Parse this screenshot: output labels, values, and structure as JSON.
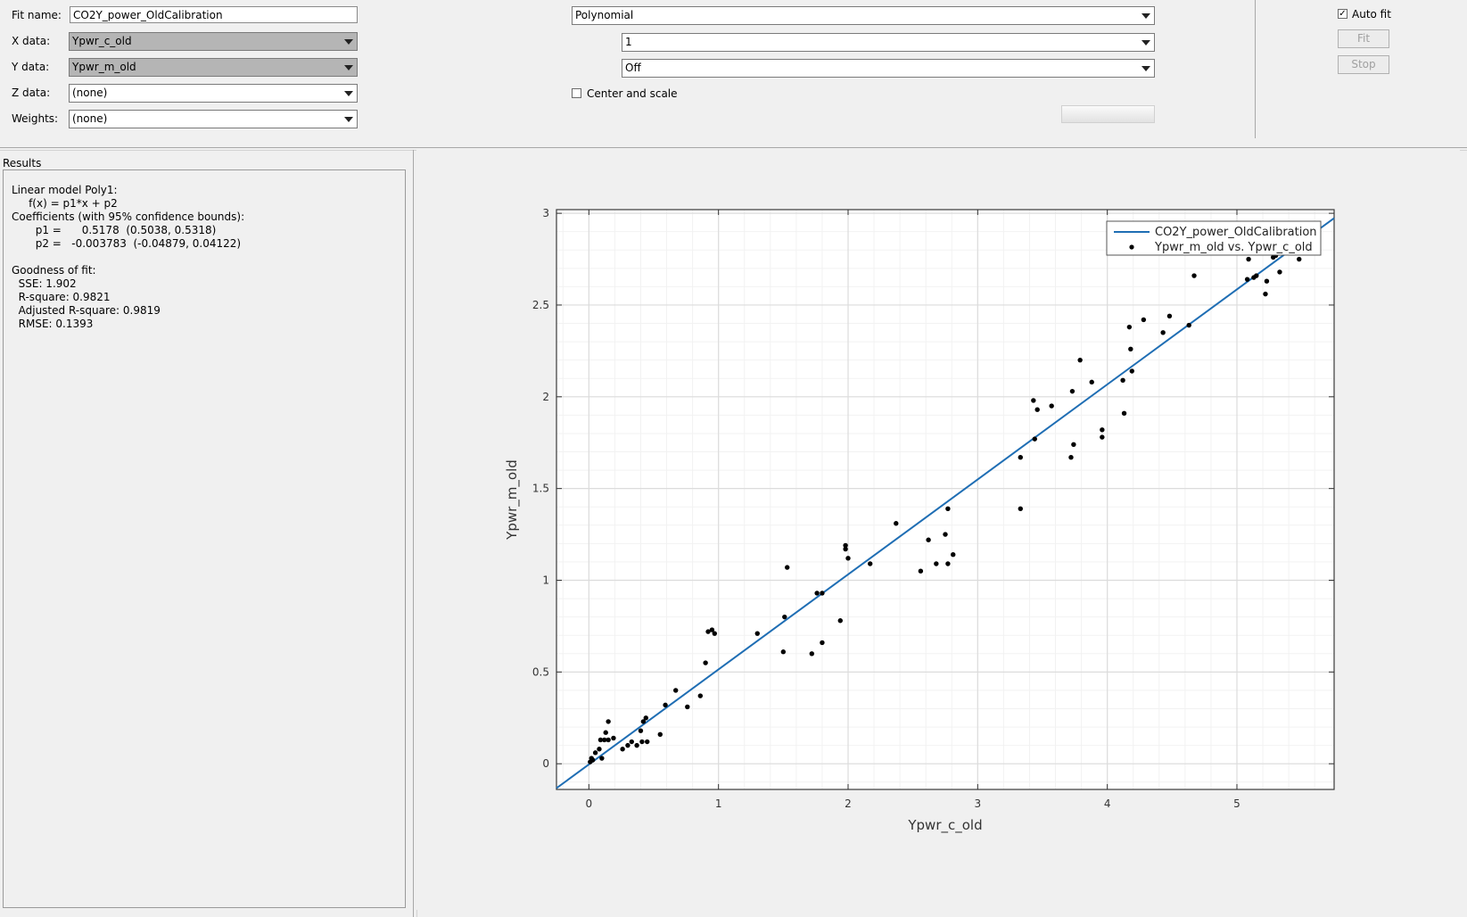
{
  "fit_panel": {
    "fit_name_label": "Fit name:",
    "fit_name_value": "CO2Y_power_OldCalibration",
    "x_data_label": "X data:",
    "x_data_value": "Ypwr_c_old",
    "y_data_label": "Y data:",
    "y_data_value": "Ypwr_m_old",
    "z_data_label": "Z data:",
    "z_data_value": "(none)",
    "weights_label": "Weights:",
    "weights_value": "(none)"
  },
  "fit_type": {
    "type_value": "Polynomial",
    "degree_value": "1",
    "robust_value": "Off",
    "center_scale_label": "Center and scale",
    "center_scale_checked": false
  },
  "actions": {
    "auto_fit_label": "Auto fit",
    "auto_fit_checked": true,
    "fit_label": "Fit",
    "stop_label": "Stop"
  },
  "results": {
    "title": "Results",
    "lines": [
      "Linear model Poly1:",
      "     f(x) = p1*x + p2",
      "Coefficients (with 95% confidence bounds):",
      "       p1 =      0.5178  (0.5038, 0.5318)",
      "       p2 =   -0.003783  (-0.04879, 0.04122)",
      "",
      "Goodness of fit:",
      "  SSE: 1.902",
      "  R-square: 0.9821",
      "  Adjusted R-square: 0.9819",
      "  RMSE: 0.1393"
    ]
  },
  "chart_data": {
    "type": "scatter",
    "xlabel": "Ypwr_c_old",
    "ylabel": "Ypwr_m_old",
    "xlim": [
      -0.25,
      5.75
    ],
    "ylim": [
      -0.14,
      3.02
    ],
    "xticks": [
      0,
      1,
      2,
      3,
      4,
      5
    ],
    "yticks": [
      0,
      0.5,
      1,
      1.5,
      2,
      2.5,
      3
    ],
    "ytick_labels": [
      "0",
      "0.5",
      "1",
      "1.5",
      "2",
      "2.5",
      "3"
    ],
    "grid": true,
    "legend_position": "top-right",
    "fit": {
      "name": "CO2Y_power_OldCalibration",
      "p1": 0.5178,
      "p2": -0.003783,
      "color": "#1f6eb4"
    },
    "series": [
      {
        "name": "Ypwr_m_old vs. Ypwr_c_old",
        "color": "#000000",
        "points": [
          [
            0.01,
            0.01
          ],
          [
            0.02,
            0.03
          ],
          [
            0.03,
            0.02
          ],
          [
            0.05,
            0.06
          ],
          [
            0.08,
            0.08
          ],
          [
            0.09,
            0.13
          ],
          [
            0.1,
            0.03
          ],
          [
            0.12,
            0.13
          ],
          [
            0.13,
            0.17
          ],
          [
            0.15,
            0.23
          ],
          [
            0.15,
            0.13
          ],
          [
            0.19,
            0.14
          ],
          [
            0.26,
            0.08
          ],
          [
            0.3,
            0.1
          ],
          [
            0.33,
            0.12
          ],
          [
            0.37,
            0.1
          ],
          [
            0.4,
            0.18
          ],
          [
            0.41,
            0.12
          ],
          [
            0.42,
            0.23
          ],
          [
            0.44,
            0.25
          ],
          [
            0.45,
            0.12
          ],
          [
            0.55,
            0.16
          ],
          [
            0.59,
            0.32
          ],
          [
            0.67,
            0.4
          ],
          [
            0.76,
            0.31
          ],
          [
            0.86,
            0.37
          ],
          [
            0.9,
            0.55
          ],
          [
            0.92,
            0.72
          ],
          [
            0.95,
            0.73
          ],
          [
            0.97,
            0.71
          ],
          [
            1.3,
            0.71
          ],
          [
            1.5,
            0.61
          ],
          [
            1.51,
            0.8
          ],
          [
            1.53,
            1.07
          ],
          [
            1.72,
            0.6
          ],
          [
            1.76,
            0.93
          ],
          [
            1.8,
            0.93
          ],
          [
            1.8,
            0.66
          ],
          [
            1.94,
            0.78
          ],
          [
            1.98,
            1.19
          ],
          [
            1.98,
            1.17
          ],
          [
            2.0,
            1.12
          ],
          [
            2.17,
            1.09
          ],
          [
            2.37,
            1.31
          ],
          [
            2.56,
            1.05
          ],
          [
            2.62,
            1.22
          ],
          [
            2.68,
            1.09
          ],
          [
            2.75,
            1.25
          ],
          [
            2.77,
            1.39
          ],
          [
            2.77,
            1.09
          ],
          [
            2.81,
            1.14
          ],
          [
            3.33,
            1.67
          ],
          [
            3.33,
            1.39
          ],
          [
            3.43,
            1.98
          ],
          [
            3.44,
            1.77
          ],
          [
            3.46,
            1.93
          ],
          [
            3.57,
            1.95
          ],
          [
            3.72,
            1.67
          ],
          [
            3.73,
            2.03
          ],
          [
            3.74,
            1.74
          ],
          [
            3.79,
            2.2
          ],
          [
            3.88,
            2.08
          ],
          [
            3.96,
            1.82
          ],
          [
            3.96,
            1.78
          ],
          [
            4.12,
            2.09
          ],
          [
            4.13,
            1.91
          ],
          [
            4.17,
            2.38
          ],
          [
            4.18,
            2.26
          ],
          [
            4.19,
            2.14
          ],
          [
            4.28,
            2.42
          ],
          [
            4.43,
            2.35
          ],
          [
            4.48,
            2.44
          ],
          [
            4.63,
            2.39
          ],
          [
            4.67,
            2.66
          ],
          [
            5.08,
            2.64
          ],
          [
            5.09,
            2.75
          ],
          [
            5.13,
            2.65
          ],
          [
            5.15,
            2.66
          ],
          [
            5.22,
            2.56
          ],
          [
            5.23,
            2.63
          ],
          [
            5.28,
            2.76
          ],
          [
            5.3,
            2.77
          ],
          [
            5.33,
            2.68
          ],
          [
            5.48,
            2.75
          ],
          [
            5.49,
            2.8
          ],
          [
            5.55,
            2.85
          ]
        ]
      }
    ]
  }
}
